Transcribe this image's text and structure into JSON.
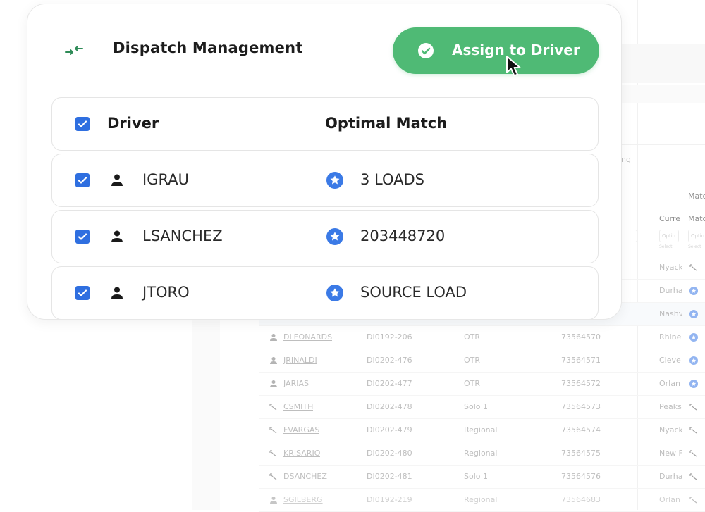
{
  "modal": {
    "title": "Dispatch Management",
    "header_icon": "swap-arrows-icon",
    "assign_button_label": "Assign to Driver",
    "columns": {
      "driver": "Driver",
      "match": "Optimal Match"
    },
    "rows": [
      {
        "driver": "IGRAU",
        "match": "3 LOADS",
        "checked": true
      },
      {
        "driver": "LSANCHEZ",
        "match": "203448720",
        "checked": true
      },
      {
        "driver": "JTORO",
        "match": "SOURCE LOAD",
        "checked": true
      }
    ]
  },
  "background": {
    "filter_text": "ing",
    "headers": {
      "current": "Curre",
      "match_top": "Matc",
      "match": "Matc"
    },
    "filter_placeholders": {
      "current": "Optio",
      "match": "Optio"
    },
    "select_label": "Select",
    "rows": [
      {
        "city": "Nyack"
      },
      {
        "city": "Durha"
      },
      {
        "city": "Nashv"
      },
      {
        "driver": "DLEONARDS",
        "id": "DI0192-206",
        "type": "OTR",
        "num": "73564570",
        "city": "Rhine"
      },
      {
        "driver": "JRINALDI",
        "id": "DI0202-476",
        "type": "OTR",
        "num": "73564571",
        "city": "Cleve"
      },
      {
        "driver": "JARIAS",
        "id": "DI0202-477",
        "type": "OTR",
        "num": "73564572",
        "city": "Orlan"
      },
      {
        "driver": "CSMITH",
        "id": "DI0202-478",
        "type": "Solo 1",
        "num": "73564573",
        "city": "Peaks"
      },
      {
        "driver": "FVARGAS",
        "id": "DI0202-479",
        "type": "Regional",
        "num": "73564574",
        "city": "Nyack"
      },
      {
        "driver": "KRISARIO",
        "id": "DI0202-480",
        "type": "Regional",
        "num": "73564575",
        "city": "New F"
      },
      {
        "driver": "DSANCHEZ",
        "id": "DI0202-481",
        "type": "Solo 1",
        "num": "73564576",
        "city": "Durha"
      },
      {
        "driver": "SGILBERG",
        "id": "DI0192-219",
        "type": "Regional",
        "num": "73564683",
        "city": "Orlan"
      }
    ]
  },
  "colors": {
    "assign_green": "#4fba75",
    "checkbox_blue": "#2f6fe0",
    "star_blue": "#3b7ae6",
    "icon_green": "#2e8b57"
  }
}
